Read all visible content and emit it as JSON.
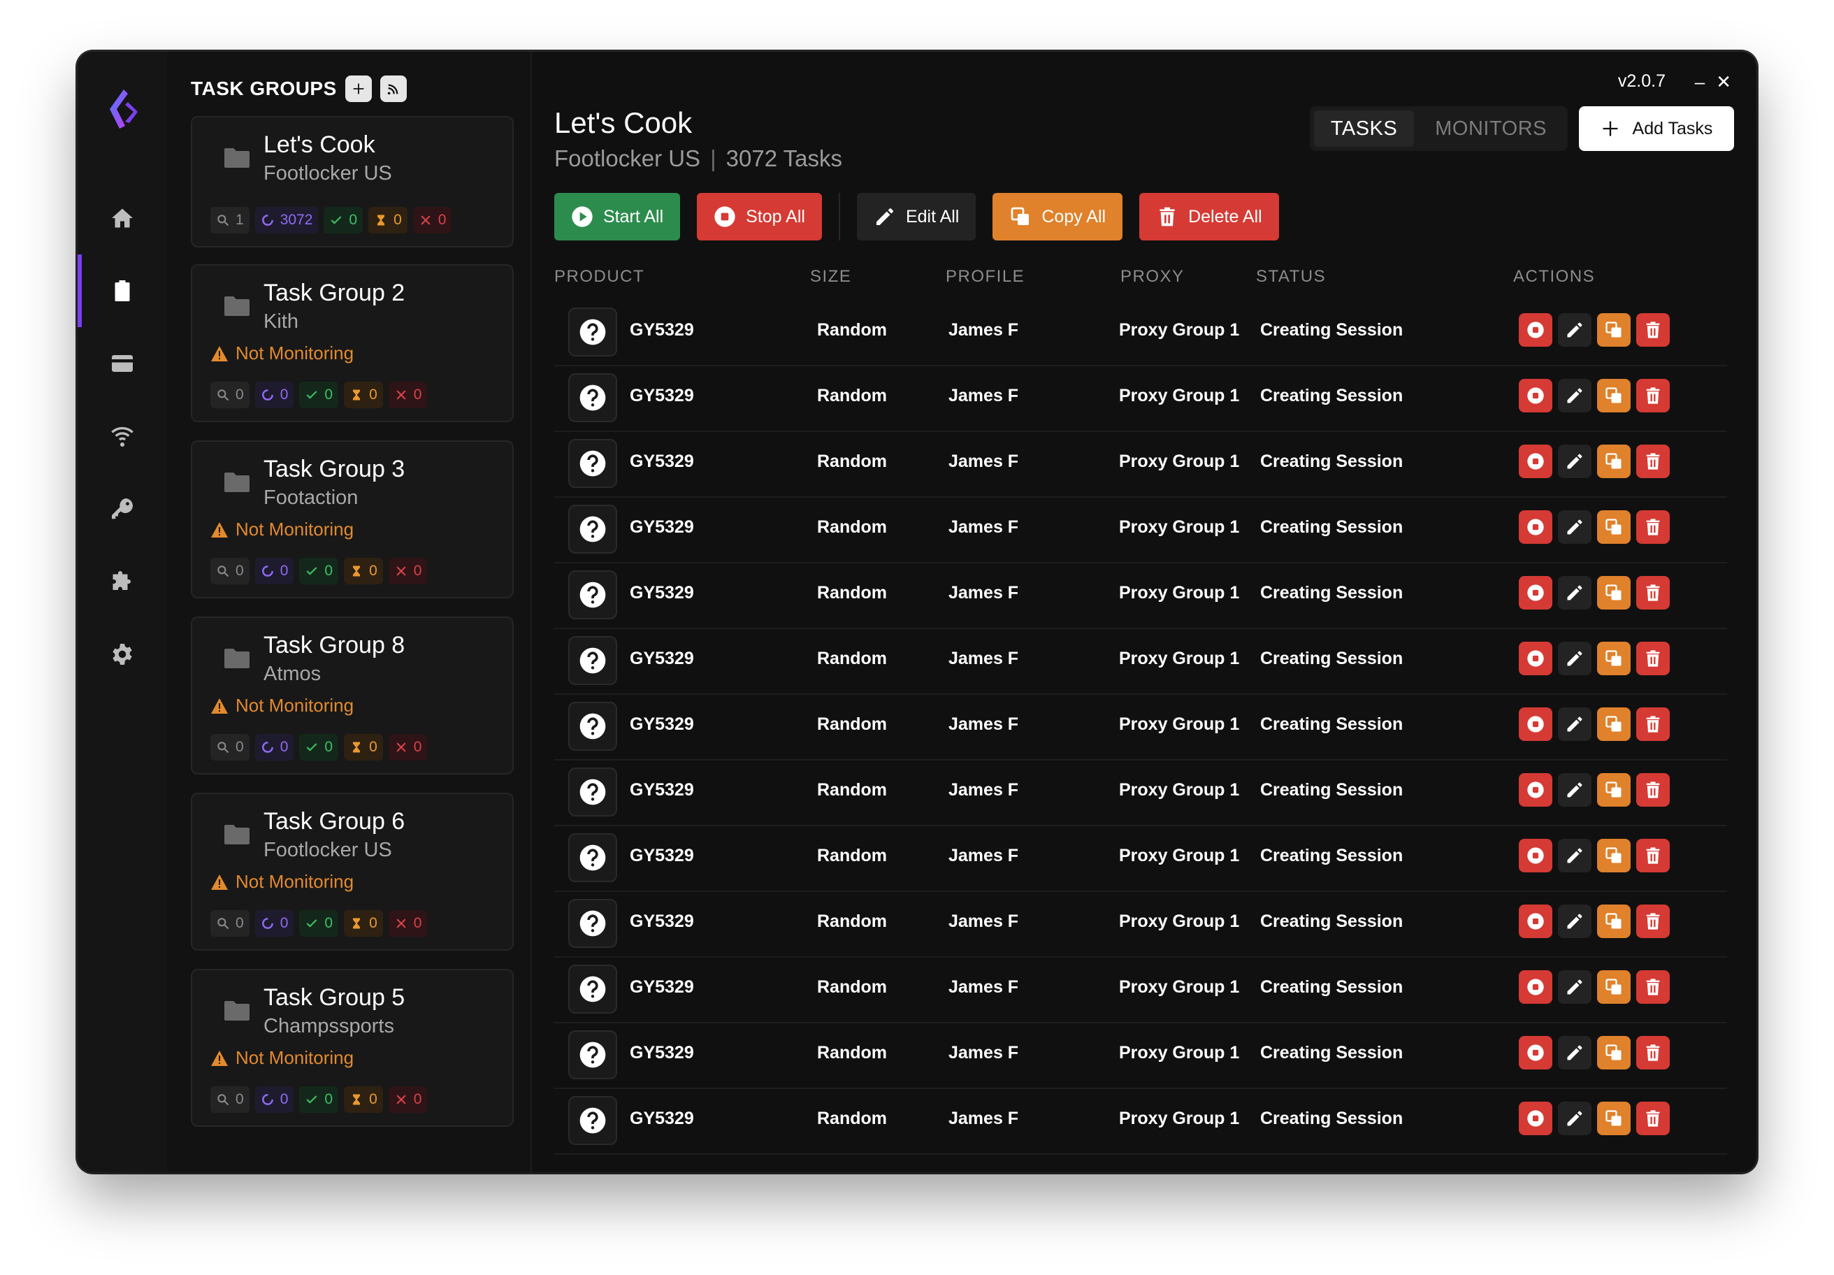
{
  "app": {
    "version": "v2.0.7",
    "minimize": "–",
    "close": "✕"
  },
  "groups_panel": {
    "title": "TASK GROUPS",
    "groups": [
      {
        "name": "Let's Cook",
        "site": "Footlocker US",
        "warning": "",
        "stats": {
          "search": "1",
          "running": "3072",
          "ok": "0",
          "pending": "0",
          "failed": "0"
        }
      },
      {
        "name": "Task Group 2",
        "site": "Kith",
        "warning": "Not Monitoring",
        "stats": {
          "search": "0",
          "running": "0",
          "ok": "0",
          "pending": "0",
          "failed": "0"
        }
      },
      {
        "name": "Task Group 3",
        "site": "Footaction",
        "warning": "Not Monitoring",
        "stats": {
          "search": "0",
          "running": "0",
          "ok": "0",
          "pending": "0",
          "failed": "0"
        }
      },
      {
        "name": "Task Group 8",
        "site": "Atmos",
        "warning": "Not Monitoring",
        "stats": {
          "search": "0",
          "running": "0",
          "ok": "0",
          "pending": "0",
          "failed": "0"
        }
      },
      {
        "name": "Task Group 6",
        "site": "Footlocker US",
        "warning": "Not Monitoring",
        "stats": {
          "search": "0",
          "running": "0",
          "ok": "0",
          "pending": "0",
          "failed": "0"
        }
      },
      {
        "name": "Task Group 5",
        "site": "Champssports",
        "warning": "Not Monitoring",
        "stats": {
          "search": "0",
          "running": "0",
          "ok": "0",
          "pending": "0",
          "failed": "0"
        }
      }
    ]
  },
  "header": {
    "title": "Let's Cook",
    "site": "Footlocker US",
    "divider": "|",
    "task_count": "3072 Tasks",
    "tabs": [
      "TASKS",
      "MONITORS"
    ],
    "add_label": "Add Tasks"
  },
  "toolbar": {
    "start": "Start All",
    "stop": "Stop All",
    "edit": "Edit All",
    "copy": "Copy All",
    "delete": "Delete All"
  },
  "table": {
    "columns": [
      "PRODUCT",
      "SIZE",
      "PROFILE",
      "PROXY",
      "STATUS",
      "ACTIONS"
    ],
    "rows": [
      {
        "product": "GY5329",
        "size": "Random",
        "profile": "James F",
        "proxy": "Proxy Group 1",
        "status": "Creating Session"
      },
      {
        "product": "GY5329",
        "size": "Random",
        "profile": "James F",
        "proxy": "Proxy Group 1",
        "status": "Creating Session"
      },
      {
        "product": "GY5329",
        "size": "Random",
        "profile": "James F",
        "proxy": "Proxy Group 1",
        "status": "Creating Session"
      },
      {
        "product": "GY5329",
        "size": "Random",
        "profile": "James F",
        "proxy": "Proxy Group 1",
        "status": "Creating Session"
      },
      {
        "product": "GY5329",
        "size": "Random",
        "profile": "James F",
        "proxy": "Proxy Group 1",
        "status": "Creating Session"
      },
      {
        "product": "GY5329",
        "size": "Random",
        "profile": "James F",
        "proxy": "Proxy Group 1",
        "status": "Creating Session"
      },
      {
        "product": "GY5329",
        "size": "Random",
        "profile": "James F",
        "proxy": "Proxy Group 1",
        "status": "Creating Session"
      },
      {
        "product": "GY5329",
        "size": "Random",
        "profile": "James F",
        "proxy": "Proxy Group 1",
        "status": "Creating Session"
      },
      {
        "product": "GY5329",
        "size": "Random",
        "profile": "James F",
        "proxy": "Proxy Group 1",
        "status": "Creating Session"
      },
      {
        "product": "GY5329",
        "size": "Random",
        "profile": "James F",
        "proxy": "Proxy Group 1",
        "status": "Creating Session"
      },
      {
        "product": "GY5329",
        "size": "Random",
        "profile": "James F",
        "proxy": "Proxy Group 1",
        "status": "Creating Session"
      },
      {
        "product": "GY5329",
        "size": "Random",
        "profile": "James F",
        "proxy": "Proxy Group 1",
        "status": "Creating Session"
      },
      {
        "product": "GY5329",
        "size": "Random",
        "profile": "James F",
        "proxy": "Proxy Group 1",
        "status": "Creating Session"
      }
    ]
  },
  "sidebar_icons": [
    "home-icon",
    "clipboard-icon",
    "card-icon",
    "wifi-icon",
    "key-icon",
    "puzzle-icon",
    "gear-icon"
  ],
  "colors": {
    "accent": "#7b3ff2",
    "start": "#2c8c4e",
    "stop": "#d63a34",
    "copy": "#e0812b",
    "warning": "#e38a2c"
  }
}
